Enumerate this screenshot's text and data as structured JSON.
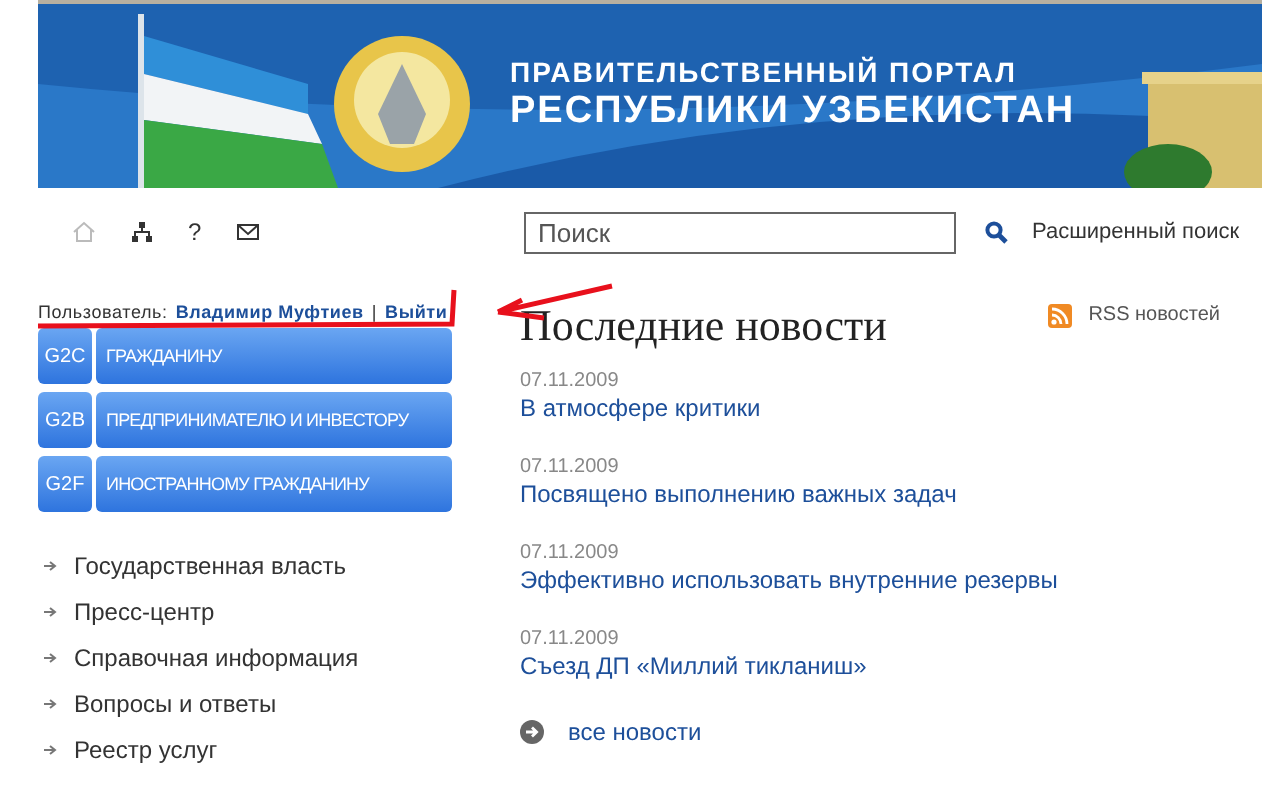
{
  "banner": {
    "title_line_1": "ПРАВИТЕЛЬСТВЕННЫЙ ПОРТАЛ",
    "title_line_2": "РЕСПУБЛИКИ УЗБЕКИСТАН"
  },
  "toolbar": {
    "help": "?"
  },
  "search": {
    "placeholder": "Поиск",
    "advanced": "Расширенный поиск"
  },
  "user": {
    "label": "Пользователь:",
    "name": "Владимир Муфтиев",
    "separator": "|",
    "logout": "Выйти"
  },
  "portals": [
    {
      "code": "G2C",
      "label": "ГРАЖДАНИНУ"
    },
    {
      "code": "G2B",
      "label": "ПРЕДПРИНИМАТЕЛЮ И ИНВЕСТОРУ"
    },
    {
      "code": "G2F",
      "label": "ИНОСТРАННОМУ ГРАЖДАНИНУ"
    }
  ],
  "menu": [
    "Государственная власть",
    "Пресс-центр",
    "Справочная информация",
    "Вопросы и ответы",
    "Реестр услуг"
  ],
  "news": {
    "heading": "Последние новости",
    "rss": "RSS новостей",
    "items": [
      {
        "date": "07.11.2009",
        "title": "В атмосфере критики"
      },
      {
        "date": "07.11.2009",
        "title": "Посвящено выполнению важных задач"
      },
      {
        "date": "07.11.2009",
        "title": "Эффективно использовать внутренние резервы"
      },
      {
        "date": "07.11.2009",
        "title": "Съезд ДП «Миллий тикланиш»"
      }
    ],
    "all": "все новости"
  }
}
